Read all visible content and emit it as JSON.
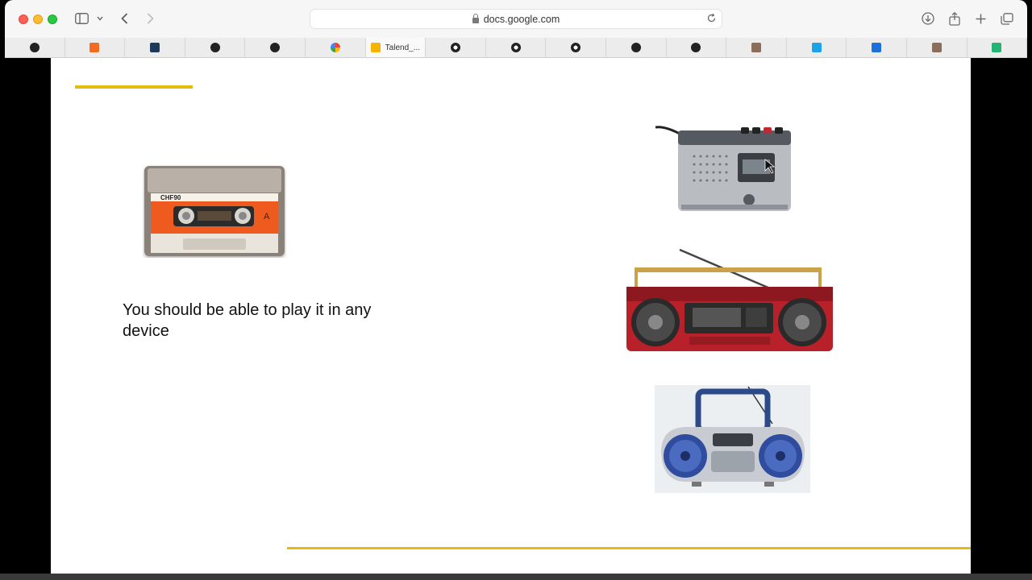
{
  "browser": {
    "url": "docs.google.com",
    "tabs": [
      {
        "label": "",
        "icon": "github-icon",
        "color": "#222222"
      },
      {
        "label": "",
        "icon": "cube-icon",
        "color": "#f26b21"
      },
      {
        "label": "",
        "icon": "dlt-icon",
        "color": "#1b3a5c"
      },
      {
        "label": "",
        "icon": "github-icon",
        "color": "#222222"
      },
      {
        "label": "",
        "icon": "github-icon",
        "color": "#222222"
      },
      {
        "label": "",
        "icon": "google-icon",
        "color": "#4285f4"
      },
      {
        "label": "Talend_...",
        "icon": "slides-icon",
        "color": "#f4b400",
        "active": true
      },
      {
        "label": "",
        "icon": "openai-icon",
        "color": "#222222"
      },
      {
        "label": "",
        "icon": "openai-icon",
        "color": "#222222"
      },
      {
        "label": "",
        "icon": "openai-icon",
        "color": "#222222"
      },
      {
        "label": "",
        "icon": "github-icon",
        "color": "#222222"
      },
      {
        "label": "",
        "icon": "github-icon",
        "color": "#222222"
      },
      {
        "label": "",
        "icon": "avatar-icon",
        "color": "#8a6d5a"
      },
      {
        "label": "",
        "icon": "app-icon",
        "color": "#1aa3e8"
      },
      {
        "label": "",
        "icon": "bookmark-icon",
        "color": "#1e6fd9"
      },
      {
        "label": "",
        "icon": "avatar-icon",
        "color": "#8a6d5a"
      },
      {
        "label": "",
        "icon": "nm-icon",
        "color": "#22b573"
      }
    ]
  },
  "slide": {
    "text": "You should be able to play it in any device",
    "accent_color": "#e8b90f",
    "images": {
      "cassette": "cassette-tape-image",
      "recorder": "cassette-recorder-image",
      "boombox_red": "red-boombox-image",
      "boombox_silver": "silver-boombox-image"
    }
  }
}
